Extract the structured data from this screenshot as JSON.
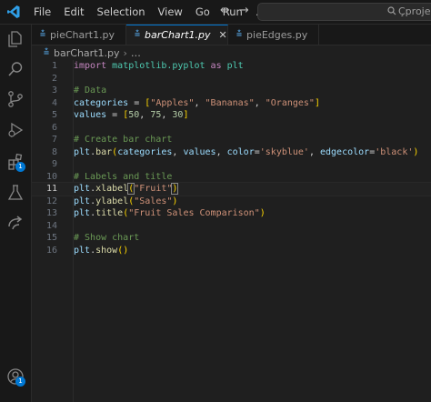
{
  "menu": [
    "File",
    "Edit",
    "Selection",
    "View",
    "Go",
    "Run",
    "…"
  ],
  "command_center": "Çprojects",
  "tabs": [
    {
      "label": "pieChart1.py"
    },
    {
      "label": "barChart1.py"
    },
    {
      "label": "pieEdges.py"
    }
  ],
  "breadcrumb": {
    "file": "barChart1.py",
    "more": "…"
  },
  "activity_badges": {
    "extensions": "1",
    "accounts": "1"
  },
  "code": {
    "line_numbers": [
      "1",
      "2",
      "3",
      "4",
      "5",
      "6",
      "7",
      "8",
      "9",
      "10",
      "11",
      "12",
      "13",
      "14",
      "15",
      "16"
    ],
    "current_line": 11,
    "l1": {
      "kw": "import",
      "mod": "matplotlib.pyplot",
      "as": "as",
      "alias": "plt"
    },
    "l3": "# Data",
    "l4": {
      "var": "categories",
      "eq": " = ",
      "open": "[",
      "a": "\"Apples\"",
      "c1": ", ",
      "b": "\"Bananas\"",
      "c2": ", ",
      "c": "\"Oranges\"",
      "close": "]"
    },
    "l5": {
      "var": "values",
      "eq": " = ",
      "open": "[",
      "a": "50",
      "c1": ", ",
      "b": "75",
      "c2": ", ",
      "c": "30",
      "close": "]"
    },
    "l7": "# Create bar chart",
    "l8": {
      "obj": "plt",
      "dot": ".",
      "fn": "bar",
      "open": "(",
      "a1": "categories",
      "c1": ", ",
      "a2": "values",
      "c2": ", ",
      "k1": "color",
      "e1": "=",
      "v1": "'skyblue'",
      "c3": ", ",
      "k2": "edgecolor",
      "e2": "=",
      "v2": "'black'",
      "close": ")"
    },
    "l10": "# Labels and title",
    "l11": {
      "obj": "plt",
      "dot": ".",
      "fn": "xlabel",
      "open": "(",
      "arg": "\"Fruit\"",
      "close": ")"
    },
    "l12": {
      "obj": "plt",
      "dot": ".",
      "fn": "ylabel",
      "open": "(",
      "arg": "\"Sales\"",
      "close": ")"
    },
    "l13": {
      "obj": "plt",
      "dot": ".",
      "fn": "title",
      "open": "(",
      "arg": "\"Fruit Sales Comparison\"",
      "close": ")"
    },
    "l15": "# Show chart",
    "l16": {
      "obj": "plt",
      "dot": ".",
      "fn": "show",
      "parens": "()"
    }
  },
  "icons": [
    "vscode-logo-icon",
    "back-arrow-icon",
    "forward-arrow-icon",
    "search-icon",
    "explorer-icon",
    "source-control-icon",
    "run-debug-icon",
    "extensions-icon",
    "testing-icon",
    "remote-icon",
    "account-icon",
    "python-file-icon",
    "close-icon",
    "chevron-right-icon"
  ],
  "colors": {
    "accent": "#0078d4",
    "keyword": "#c586c0",
    "string": "#ce9178",
    "comment": "#6a9955",
    "number": "#b5cea8",
    "function": "#dcdcaa"
  }
}
